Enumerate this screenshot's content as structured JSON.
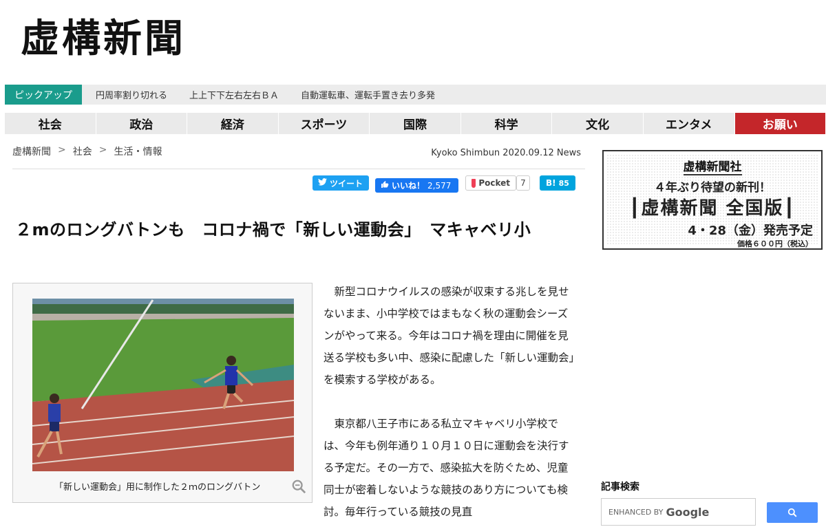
{
  "site": {
    "logo": "虚構新聞"
  },
  "ticker": {
    "label": "ピックアップ",
    "items": [
      "円周率割り切れる",
      "上上下下左右左右ＢＡ",
      "自動運転車、運転手置き去り多発"
    ]
  },
  "nav": [
    "社会",
    "政治",
    "経済",
    "スポーツ",
    "国際",
    "科学",
    "文化",
    "エンタメ",
    "お願い"
  ],
  "breadcrumb": [
    "虚構新聞",
    "社会",
    "生活・情報"
  ],
  "breadcrumb_sep": ">",
  "dateline": "Kyoko Shimbun 2020.09.12 News",
  "share": {
    "tweet": "ツイート",
    "like": "いいね！",
    "like_count": "2,577",
    "pocket": "Pocket",
    "pocket_count": "7",
    "hatena": "B!",
    "hatena_count": "85"
  },
  "headline": "２mのロングバトンも　コロナ禍で「新しい運動会」　マキャベリ小",
  "photo_caption": "「新しい運動会」用に制作した２ｍのロングバトン",
  "body": [
    "新型コロナウイルスの感染が収束する兆しを見せないまま、小中学校ではまもなく秋の運動会シーズンがやって来る。今年はコロナ禍を理由に開催を見送る学校も多い中、感染に配慮した「新しい運動会」を模索する学校がある。",
    "東京都八王子市にある私立マキャベリ小学校では、今年も例年通り１０月１０日に運動会を決行する予定だ。その一方で、感染拡大を防ぐため、児童同士が密着しないような競技のあり方についても検討。毎年行っている競技の見直"
  ],
  "ad": {
    "title": "虚構新聞社",
    "line1": "４年ぶり待望の新刊！",
    "line2": "┃虚構新聞 全国版┃",
    "line3": "4・28（金）発売予定",
    "line4": "価格６００円（税込）"
  },
  "search": {
    "title": "記事検索",
    "enhanced": "ENHANCED BY",
    "google": "Google"
  }
}
